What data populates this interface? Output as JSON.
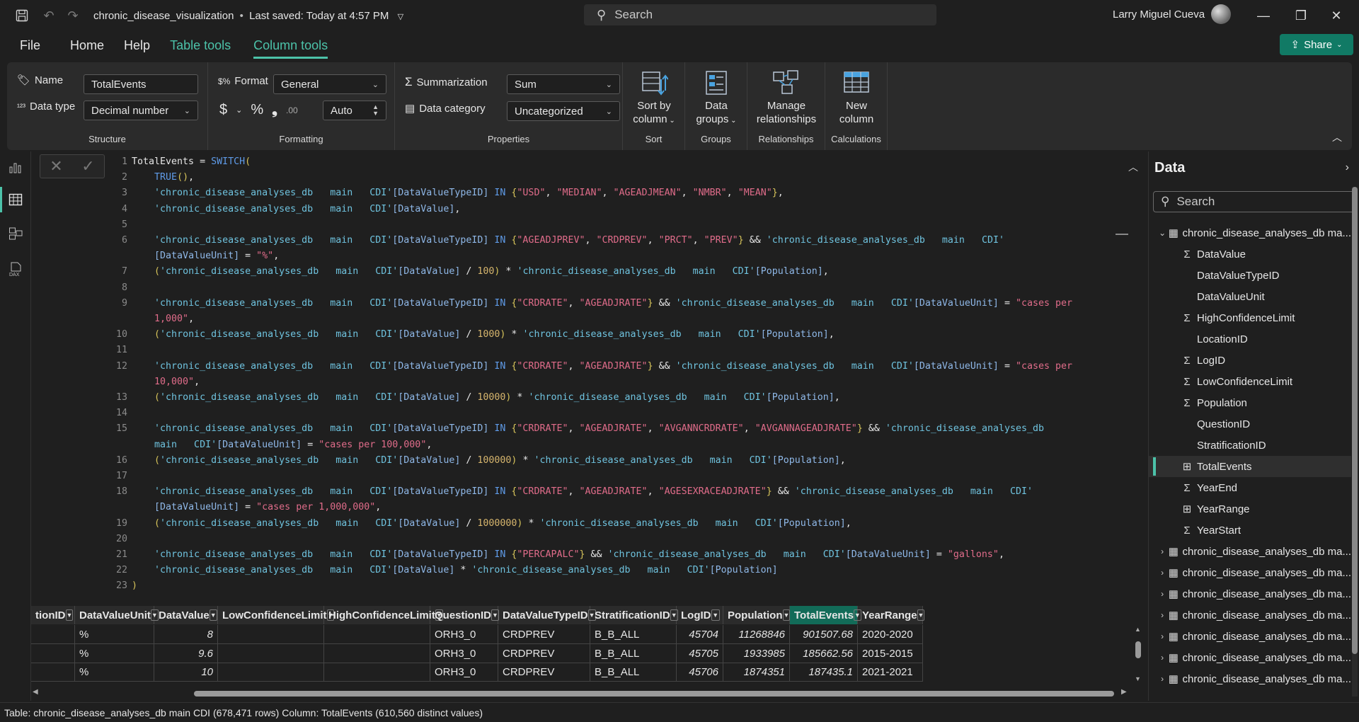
{
  "titlebar": {
    "doc_name": "chronic_disease_visualization",
    "saved_status": "Last saved: Today at 4:57 PM",
    "search_placeholder": "Search",
    "user_name": "Larry Miguel Cueva"
  },
  "menu": {
    "file": "File",
    "home": "Home",
    "help": "Help",
    "table_tools": "Table tools",
    "column_tools": "Column tools",
    "share": "Share"
  },
  "ribbon": {
    "name_label": "Name",
    "name_value": "TotalEvents",
    "datatype_label": "Data type",
    "datatype_value": "Decimal number",
    "structure_label": "Structure",
    "format_label": "Format",
    "format_value": "General",
    "decimals_value": "Auto",
    "formatting_label": "Formatting",
    "summarization_label": "Summarization",
    "summarization_value": "Sum",
    "datacategory_label": "Data category",
    "datacategory_value": "Uncategorized",
    "properties_label": "Properties",
    "sort_btn_line1": "Sort by",
    "sort_btn_line2": "column",
    "sort_group": "Sort",
    "datagroups_line1": "Data",
    "datagroups_line2": "groups",
    "groups_group": "Groups",
    "manage_line1": "Manage",
    "manage_line2": "relationships",
    "relationships_group": "Relationships",
    "newcol_line1": "New",
    "newcol_line2": "column",
    "calculations_group": "Calculations"
  },
  "dax_lines": [
    {
      "n": "1",
      "t": [
        [
          "k",
          "TotalEvents = "
        ],
        [
          "fn",
          "SWITCH"
        ],
        [
          "br",
          "("
        ]
      ]
    },
    {
      "n": "2",
      "t": [
        [
          "k",
          "    "
        ],
        [
          "fn",
          "TRUE"
        ],
        [
          "br",
          "()"
        ],
        [
          "k",
          ","
        ]
      ]
    },
    {
      "n": "3",
      "t": [
        [
          "k",
          "    "
        ],
        [
          "tb",
          "'chronic_disease_analyses_db   main   CDI'"
        ],
        [
          "col",
          "[DataValueTypeID]"
        ],
        [
          "k",
          " "
        ],
        [
          "fn",
          "IN"
        ],
        [
          "k",
          " "
        ],
        [
          "br",
          "{"
        ],
        [
          "str",
          "\"USD\""
        ],
        [
          "k",
          ", "
        ],
        [
          "str",
          "\"MEDIAN\""
        ],
        [
          "k",
          ", "
        ],
        [
          "str",
          "\"AGEADJMEAN\""
        ],
        [
          "k",
          ", "
        ],
        [
          "str",
          "\"NMBR\""
        ],
        [
          "k",
          ", "
        ],
        [
          "str",
          "\"MEAN\""
        ],
        [
          "br",
          "}"
        ],
        [
          "k",
          ","
        ]
      ]
    },
    {
      "n": "4",
      "t": [
        [
          "k",
          "    "
        ],
        [
          "tb",
          "'chronic_disease_analyses_db   main   CDI'"
        ],
        [
          "col",
          "[DataValue]"
        ],
        [
          "k",
          ","
        ]
      ]
    },
    {
      "n": "5",
      "t": []
    },
    {
      "n": "6",
      "t": [
        [
          "k",
          "    "
        ],
        [
          "tb",
          "'chronic_disease_analyses_db   main   CDI'"
        ],
        [
          "col",
          "[DataValueTypeID]"
        ],
        [
          "k",
          " "
        ],
        [
          "fn",
          "IN"
        ],
        [
          "k",
          " "
        ],
        [
          "br",
          "{"
        ],
        [
          "str",
          "\"AGEADJPREV\""
        ],
        [
          "k",
          ", "
        ],
        [
          "str",
          "\"CRDPREV\""
        ],
        [
          "k",
          ", "
        ],
        [
          "str",
          "\"PRCT\""
        ],
        [
          "k",
          ", "
        ],
        [
          "str",
          "\"PREV\""
        ],
        [
          "br",
          "}"
        ],
        [
          "k",
          " && "
        ],
        [
          "tb",
          "'chronic_disease_analyses_db   main   CDI'"
        ]
      ]
    },
    {
      "n": "",
      "t": [
        [
          "k",
          "    "
        ],
        [
          "col",
          "[DataValueUnit]"
        ],
        [
          "k",
          " = "
        ],
        [
          "str",
          "\"%\""
        ],
        [
          "k",
          ","
        ]
      ]
    },
    {
      "n": "7",
      "t": [
        [
          "k",
          "    "
        ],
        [
          "br",
          "("
        ],
        [
          "tb",
          "'chronic_disease_analyses_db   main   CDI'"
        ],
        [
          "col",
          "[DataValue]"
        ],
        [
          "k",
          " / "
        ],
        [
          "num",
          "100"
        ],
        [
          "br",
          ")"
        ],
        [
          "k",
          " * "
        ],
        [
          "tb",
          "'chronic_disease_analyses_db   main   CDI'"
        ],
        [
          "col",
          "[Population]"
        ],
        [
          "k",
          ","
        ]
      ]
    },
    {
      "n": "8",
      "t": []
    },
    {
      "n": "9",
      "t": [
        [
          "k",
          "    "
        ],
        [
          "tb",
          "'chronic_disease_analyses_db   main   CDI'"
        ],
        [
          "col",
          "[DataValueTypeID]"
        ],
        [
          "k",
          " "
        ],
        [
          "fn",
          "IN"
        ],
        [
          "k",
          " "
        ],
        [
          "br",
          "{"
        ],
        [
          "str",
          "\"CRDRATE\""
        ],
        [
          "k",
          ", "
        ],
        [
          "str",
          "\"AGEADJRATE\""
        ],
        [
          "br",
          "}"
        ],
        [
          "k",
          " && "
        ],
        [
          "tb",
          "'chronic_disease_analyses_db   main   CDI'"
        ],
        [
          "col",
          "[DataValueUnit]"
        ],
        [
          "k",
          " = "
        ],
        [
          "str",
          "\"cases per"
        ]
      ]
    },
    {
      "n": "",
      "t": [
        [
          "str",
          "    1,000\""
        ],
        [
          "k",
          ","
        ]
      ]
    },
    {
      "n": "10",
      "t": [
        [
          "k",
          "    "
        ],
        [
          "br",
          "("
        ],
        [
          "tb",
          "'chronic_disease_analyses_db   main   CDI'"
        ],
        [
          "col",
          "[DataValue]"
        ],
        [
          "k",
          " / "
        ],
        [
          "num",
          "1000"
        ],
        [
          "br",
          ")"
        ],
        [
          "k",
          " * "
        ],
        [
          "tb",
          "'chronic_disease_analyses_db   main   CDI'"
        ],
        [
          "col",
          "[Population]"
        ],
        [
          "k",
          ","
        ]
      ]
    },
    {
      "n": "11",
      "t": []
    },
    {
      "n": "12",
      "t": [
        [
          "k",
          "    "
        ],
        [
          "tb",
          "'chronic_disease_analyses_db   main   CDI'"
        ],
        [
          "col",
          "[DataValueTypeID]"
        ],
        [
          "k",
          " "
        ],
        [
          "fn",
          "IN"
        ],
        [
          "k",
          " "
        ],
        [
          "br",
          "{"
        ],
        [
          "str",
          "\"CRDRATE\""
        ],
        [
          "k",
          ", "
        ],
        [
          "str",
          "\"AGEADJRATE\""
        ],
        [
          "br",
          "}"
        ],
        [
          "k",
          " && "
        ],
        [
          "tb",
          "'chronic_disease_analyses_db   main   CDI'"
        ],
        [
          "col",
          "[DataValueUnit]"
        ],
        [
          "k",
          " = "
        ],
        [
          "str",
          "\"cases per"
        ]
      ]
    },
    {
      "n": "",
      "t": [
        [
          "str",
          "    10,000\""
        ],
        [
          "k",
          ","
        ]
      ]
    },
    {
      "n": "13",
      "t": [
        [
          "k",
          "    "
        ],
        [
          "br",
          "("
        ],
        [
          "tb",
          "'chronic_disease_analyses_db   main   CDI'"
        ],
        [
          "col",
          "[DataValue]"
        ],
        [
          "k",
          " / "
        ],
        [
          "num",
          "10000"
        ],
        [
          "br",
          ")"
        ],
        [
          "k",
          " * "
        ],
        [
          "tb",
          "'chronic_disease_analyses_db   main   CDI'"
        ],
        [
          "col",
          "[Population]"
        ],
        [
          "k",
          ","
        ]
      ]
    },
    {
      "n": "14",
      "t": []
    },
    {
      "n": "15",
      "t": [
        [
          "k",
          "    "
        ],
        [
          "tb",
          "'chronic_disease_analyses_db   main   CDI'"
        ],
        [
          "col",
          "[DataValueTypeID]"
        ],
        [
          "k",
          " "
        ],
        [
          "fn",
          "IN"
        ],
        [
          "k",
          " "
        ],
        [
          "br",
          "{"
        ],
        [
          "str",
          "\"CRDRATE\""
        ],
        [
          "k",
          ", "
        ],
        [
          "str",
          "\"AGEADJRATE\""
        ],
        [
          "k",
          ", "
        ],
        [
          "str",
          "\"AVGANNCRDRATE\""
        ],
        [
          "k",
          ", "
        ],
        [
          "str",
          "\"AVGANNAGEADJRATE\""
        ],
        [
          "br",
          "}"
        ],
        [
          "k",
          " && "
        ],
        [
          "tb",
          "'chronic_disease_analyses_db"
        ]
      ]
    },
    {
      "n": "",
      "t": [
        [
          "tb",
          "    main   CDI'"
        ],
        [
          "col",
          "[DataValueUnit]"
        ],
        [
          "k",
          " = "
        ],
        [
          "str",
          "\"cases per 100,000\""
        ],
        [
          "k",
          ","
        ]
      ]
    },
    {
      "n": "16",
      "t": [
        [
          "k",
          "    "
        ],
        [
          "br",
          "("
        ],
        [
          "tb",
          "'chronic_disease_analyses_db   main   CDI'"
        ],
        [
          "col",
          "[DataValue]"
        ],
        [
          "k",
          " / "
        ],
        [
          "num",
          "100000"
        ],
        [
          "br",
          ")"
        ],
        [
          "k",
          " * "
        ],
        [
          "tb",
          "'chronic_disease_analyses_db   main   CDI'"
        ],
        [
          "col",
          "[Population]"
        ],
        [
          "k",
          ","
        ]
      ]
    },
    {
      "n": "17",
      "t": []
    },
    {
      "n": "18",
      "t": [
        [
          "k",
          "    "
        ],
        [
          "tb",
          "'chronic_disease_analyses_db   main   CDI'"
        ],
        [
          "col",
          "[DataValueTypeID]"
        ],
        [
          "k",
          " "
        ],
        [
          "fn",
          "IN"
        ],
        [
          "k",
          " "
        ],
        [
          "br",
          "{"
        ],
        [
          "str",
          "\"CRDRATE\""
        ],
        [
          "k",
          ", "
        ],
        [
          "str",
          "\"AGEADJRATE\""
        ],
        [
          "k",
          ", "
        ],
        [
          "str",
          "\"AGESEXRACEADJRATE\""
        ],
        [
          "br",
          "}"
        ],
        [
          "k",
          " && "
        ],
        [
          "tb",
          "'chronic_disease_analyses_db   main   CDI'"
        ]
      ]
    },
    {
      "n": "",
      "t": [
        [
          "k",
          "    "
        ],
        [
          "col",
          "[DataValueUnit]"
        ],
        [
          "k",
          " = "
        ],
        [
          "str",
          "\"cases per 1,000,000\""
        ],
        [
          "k",
          ","
        ]
      ]
    },
    {
      "n": "19",
      "t": [
        [
          "k",
          "    "
        ],
        [
          "br",
          "("
        ],
        [
          "tb",
          "'chronic_disease_analyses_db   main   CDI'"
        ],
        [
          "col",
          "[DataValue]"
        ],
        [
          "k",
          " / "
        ],
        [
          "num",
          "1000000"
        ],
        [
          "br",
          ")"
        ],
        [
          "k",
          " * "
        ],
        [
          "tb",
          "'chronic_disease_analyses_db   main   CDI'"
        ],
        [
          "col",
          "[Population]"
        ],
        [
          "k",
          ","
        ]
      ]
    },
    {
      "n": "20",
      "t": []
    },
    {
      "n": "21",
      "t": [
        [
          "k",
          "    "
        ],
        [
          "tb",
          "'chronic_disease_analyses_db   main   CDI'"
        ],
        [
          "col",
          "[DataValueTypeID]"
        ],
        [
          "k",
          " "
        ],
        [
          "fn",
          "IN"
        ],
        [
          "k",
          " "
        ],
        [
          "br",
          "{"
        ],
        [
          "str",
          "\"PERCAPALC\""
        ],
        [
          "br",
          "}"
        ],
        [
          "k",
          " && "
        ],
        [
          "tb",
          "'chronic_disease_analyses_db   main   CDI'"
        ],
        [
          "col",
          "[DataValueUnit]"
        ],
        [
          "k",
          " = "
        ],
        [
          "str",
          "\"gallons\""
        ],
        [
          "k",
          ","
        ]
      ]
    },
    {
      "n": "22",
      "t": [
        [
          "k",
          "    "
        ],
        [
          "tb",
          "'chronic_disease_analyses_db   main   CDI'"
        ],
        [
          "col",
          "[DataValue]"
        ],
        [
          "k",
          " * "
        ],
        [
          "tb",
          "'chronic_disease_analyses_db   main   CDI'"
        ],
        [
          "col",
          "[Population]"
        ]
      ]
    },
    {
      "n": "23",
      "t": [
        [
          "br",
          ")"
        ]
      ]
    }
  ],
  "grid": {
    "columns": [
      {
        "label": "tionID"
      },
      {
        "label": "DataValueUnit"
      },
      {
        "label": "DataValue"
      },
      {
        "label": "LowConfidenceLimit"
      },
      {
        "label": "HighConfidenceLimit"
      },
      {
        "label": "QuestionID"
      },
      {
        "label": "DataValueTypeID"
      },
      {
        "label": "StratificationID"
      },
      {
        "label": "LogID"
      },
      {
        "label": "Population"
      },
      {
        "label": "TotalEvents"
      },
      {
        "label": "YearRange"
      }
    ],
    "rows": [
      [
        "",
        "%",
        "8",
        "",
        "",
        "ORH3_0",
        "CRDPREV",
        "B_B_ALL",
        "45704",
        "11268846",
        "901507.68",
        "2020-2020"
      ],
      [
        "",
        "%",
        "9.6",
        "",
        "",
        "ORH3_0",
        "CRDPREV",
        "B_B_ALL",
        "45705",
        "1933985",
        "185662.56",
        "2015-2015"
      ],
      [
        "",
        "%",
        "10",
        "",
        "",
        "ORH3_0",
        "CRDPREV",
        "B_B_ALL",
        "45706",
        "1874351",
        "187435.1",
        "2021-2021"
      ]
    ]
  },
  "datapanel": {
    "title": "Data",
    "search_placeholder": "Search",
    "items": [
      {
        "label": "chronic_disease_analyses_db ma...",
        "icon": "table-icon",
        "chev": "⌄",
        "level": 0
      },
      {
        "label": "DataValue",
        "icon": "sigma-icon",
        "level": 1
      },
      {
        "label": "DataValueTypeID",
        "icon": "",
        "level": 1
      },
      {
        "label": "DataValueUnit",
        "icon": "",
        "level": 1
      },
      {
        "label": "HighConfidenceLimit",
        "icon": "sigma-icon",
        "level": 1
      },
      {
        "label": "LocationID",
        "icon": "",
        "level": 1
      },
      {
        "label": "LogID",
        "icon": "sigma-icon",
        "level": 1
      },
      {
        "label": "LowConfidenceLimit",
        "icon": "sigma-icon",
        "level": 1
      },
      {
        "label": "Population",
        "icon": "sigma-icon",
        "level": 1
      },
      {
        "label": "QuestionID",
        "icon": "",
        "level": 1
      },
      {
        "label": "StratificationID",
        "icon": "",
        "level": 1
      },
      {
        "label": "TotalEvents",
        "icon": "calc-column-icon",
        "level": 1,
        "selected": true
      },
      {
        "label": "YearEnd",
        "icon": "sigma-icon",
        "level": 1
      },
      {
        "label": "YearRange",
        "icon": "calc-column-icon",
        "level": 1
      },
      {
        "label": "YearStart",
        "icon": "sigma-icon",
        "level": 1
      },
      {
        "label": "chronic_disease_analyses_db ma...",
        "icon": "table-icon",
        "chev": "›",
        "level": 0
      },
      {
        "label": "chronic_disease_analyses_db ma...",
        "icon": "table-icon",
        "chev": "›",
        "level": 0
      },
      {
        "label": "chronic_disease_analyses_db ma...",
        "icon": "table-icon",
        "chev": "›",
        "level": 0
      },
      {
        "label": "chronic_disease_analyses_db ma...",
        "icon": "table-icon",
        "chev": "›",
        "level": 0
      },
      {
        "label": "chronic_disease_analyses_db ma...",
        "icon": "table-icon",
        "chev": "›",
        "level": 0
      },
      {
        "label": "chronic_disease_analyses_db ma...",
        "icon": "table-icon",
        "chev": "›",
        "level": 0
      },
      {
        "label": "chronic_disease_analyses_db ma...",
        "icon": "table-icon",
        "chev": "›",
        "level": 0
      }
    ]
  },
  "status": {
    "text": "Table: chronic_disease_analyses_db main CDI (678,471 rows) Column: TotalEvents (610,560 distinct values)"
  },
  "colors": {
    "accent": "#4cc2a9",
    "share_bg": "#117a65",
    "selected_header": "#126b58"
  }
}
